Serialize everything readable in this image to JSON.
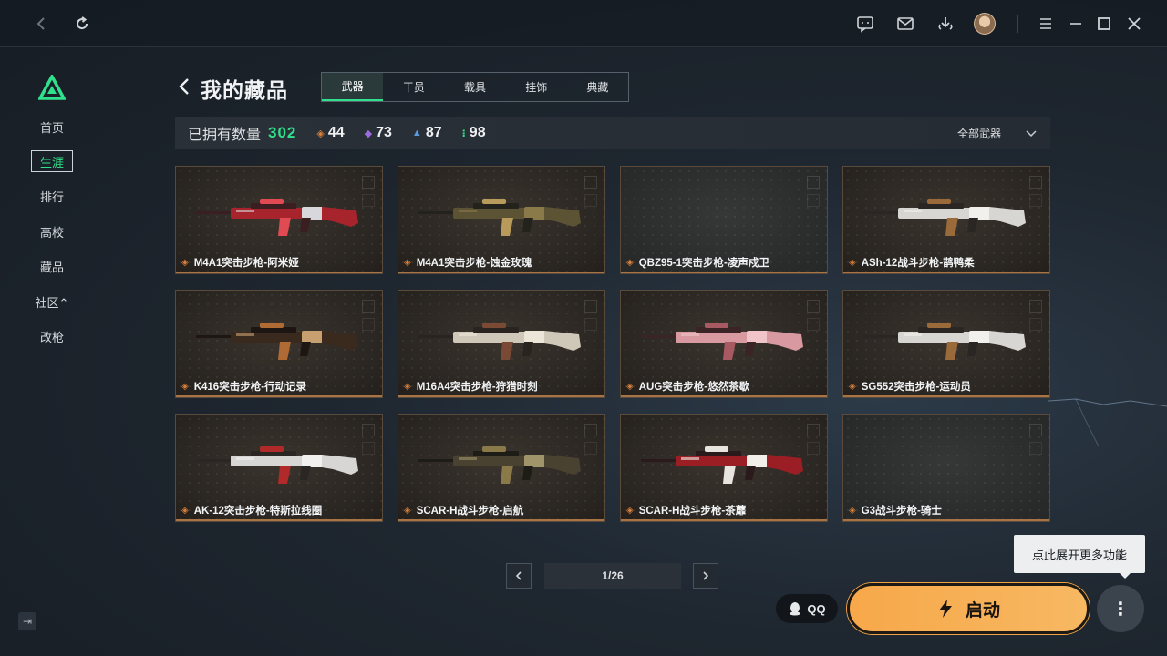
{
  "titlebar": {
    "icons": [
      "back-icon",
      "refresh-icon",
      "chat-icon",
      "mail-icon",
      "download-icon",
      "avatar",
      "menu-icon",
      "minimize-icon",
      "maximize-icon",
      "close-icon"
    ]
  },
  "sidebar": {
    "items": [
      {
        "label": "首页"
      },
      {
        "label": "生涯"
      },
      {
        "label": "排行"
      },
      {
        "label": "高校"
      },
      {
        "label": "藏品"
      },
      {
        "label": "社区⌃"
      },
      {
        "label": "改枪"
      }
    ],
    "active_index": 1,
    "accent": "#31e08c"
  },
  "header": {
    "title": "我的藏品",
    "tabs": [
      {
        "label": "武器"
      },
      {
        "label": "干员"
      },
      {
        "label": "载具"
      },
      {
        "label": "挂饰"
      },
      {
        "label": "典藏"
      }
    ],
    "active_tab": 0
  },
  "stats": {
    "label": "已拥有数量",
    "total": "302",
    "counts": [
      {
        "icon": "orange-diamond-icon",
        "color": "#d8803a",
        "value": "44"
      },
      {
        "icon": "purple-diamond-icon",
        "color": "#9a6ce0",
        "value": "73"
      },
      {
        "icon": "blue-chevron-icon",
        "color": "#5a9be0",
        "value": "87"
      },
      {
        "icon": "green-dots-icon",
        "color": "#31e08c",
        "value": "98"
      }
    ],
    "filter_label": "全部武器"
  },
  "items": [
    {
      "name": "M4A1突击步枪-阿米娅",
      "scheme": "red",
      "has_image": true
    },
    {
      "name": "M4A1突击步枪-蚀金玫瑰",
      "scheme": "gold",
      "has_image": true
    },
    {
      "name": "QBZ95-1突击步枪-凌声戍卫",
      "scheme": "none",
      "has_image": false
    },
    {
      "name": "ASh-12战斗步枪-鹊鸭柔",
      "scheme": "white",
      "has_image": true
    },
    {
      "name": "K416突击步枪-行动记录",
      "scheme": "brown",
      "has_image": true
    },
    {
      "name": "M16A4突击步枪-狩猎时刻",
      "scheme": "cream",
      "has_image": true
    },
    {
      "name": "AUG突击步枪-悠然茶歇",
      "scheme": "pink",
      "has_image": true
    },
    {
      "name": "SG552突击步枪-运动员",
      "scheme": "white",
      "has_image": true
    },
    {
      "name": "AK-12突击步枪-特斯拉线圈",
      "scheme": "white-red",
      "has_image": true
    },
    {
      "name": "SCAR-H战斗步枪-启航",
      "scheme": "olive",
      "has_image": true
    },
    {
      "name": "SCAR-H战斗步枪-茶蘼",
      "scheme": "red-white",
      "has_image": true
    },
    {
      "name": "G3战斗步枪-骑士",
      "scheme": "none",
      "has_image": false
    }
  ],
  "pagination": {
    "text": "1/26"
  },
  "actions": {
    "qq_label": "QQ",
    "launch_label": "启动",
    "launch_color": "#f7a84a",
    "tooltip": "点此展开更多功能"
  }
}
